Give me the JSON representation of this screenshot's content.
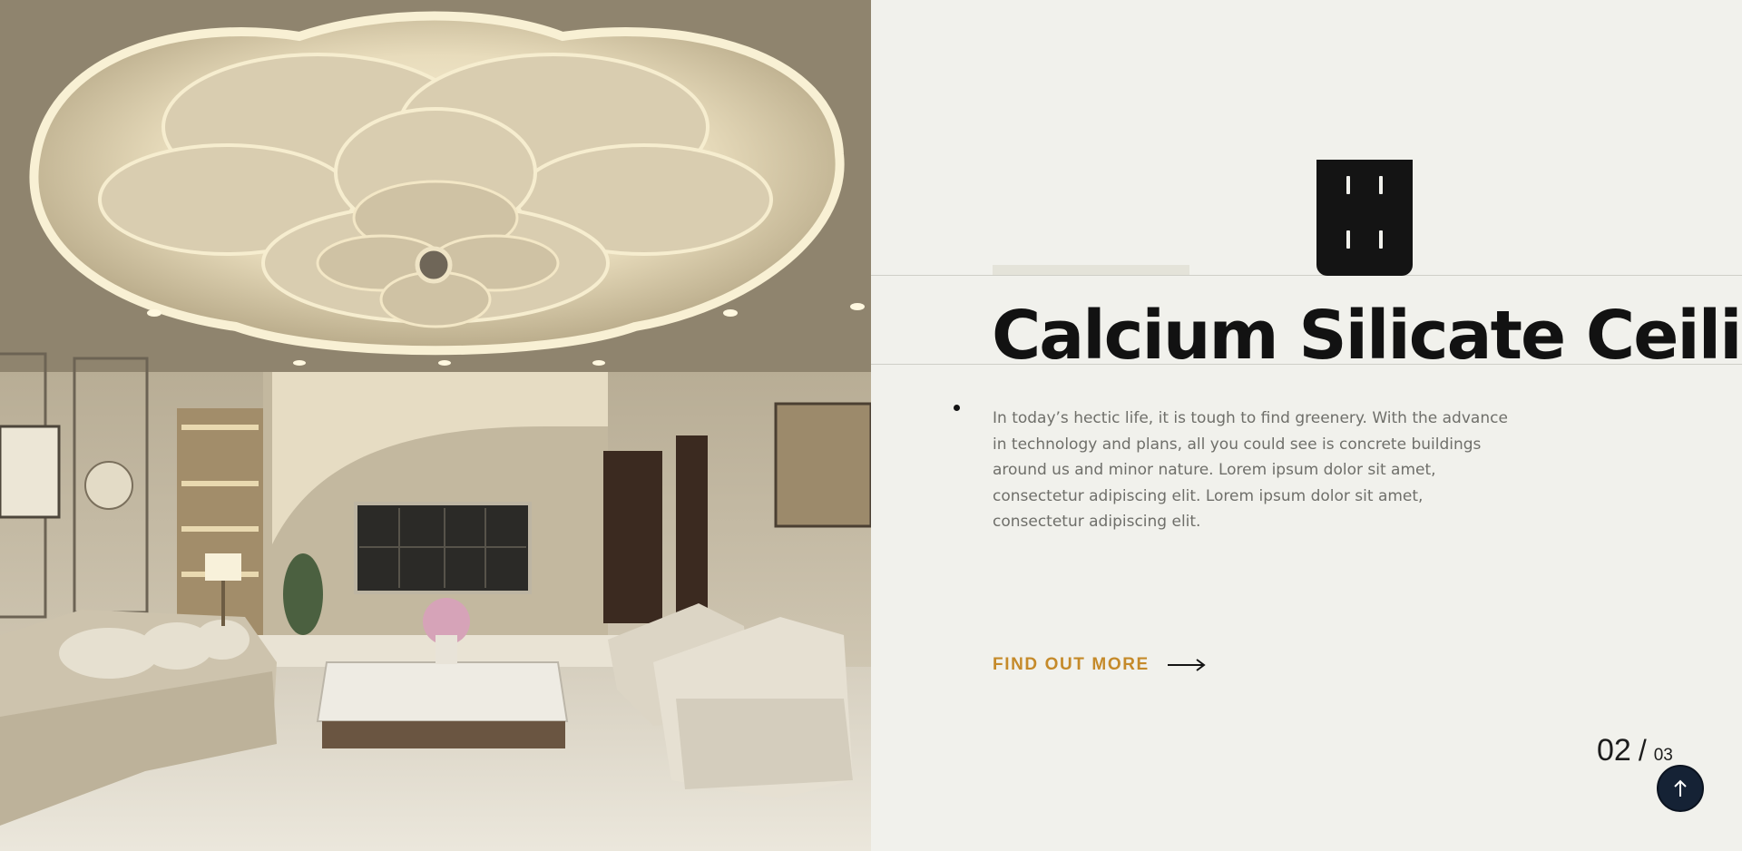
{
  "hero": {
    "image_alt": "Living room with a flower-shaped backlit calcium silicate ceiling"
  },
  "slide": {
    "title": "Calcium Silicate Ceiling",
    "description": "In today’s hectic life, it is tough to find greenery. With the advance in technology and plans, all you could see is concrete buildings around us and minor nature. Lorem ipsum dolor sit amet, consectetur adipiscing elit. Lorem ipsum dolor sit amet, consectetur adipiscing elit.",
    "cta_label": "FIND OUT MORE",
    "cta_icon": "arrow-right-icon"
  },
  "pagination": {
    "current": "02",
    "separator": "/",
    "total": "03"
  },
  "scroll_top": {
    "icon": "arrow-up-icon"
  },
  "colors": {
    "background": "#f1f1ec",
    "title": "#121212",
    "accent": "#c58a2a",
    "badge": "#141414",
    "scroll_button": "#152235"
  }
}
